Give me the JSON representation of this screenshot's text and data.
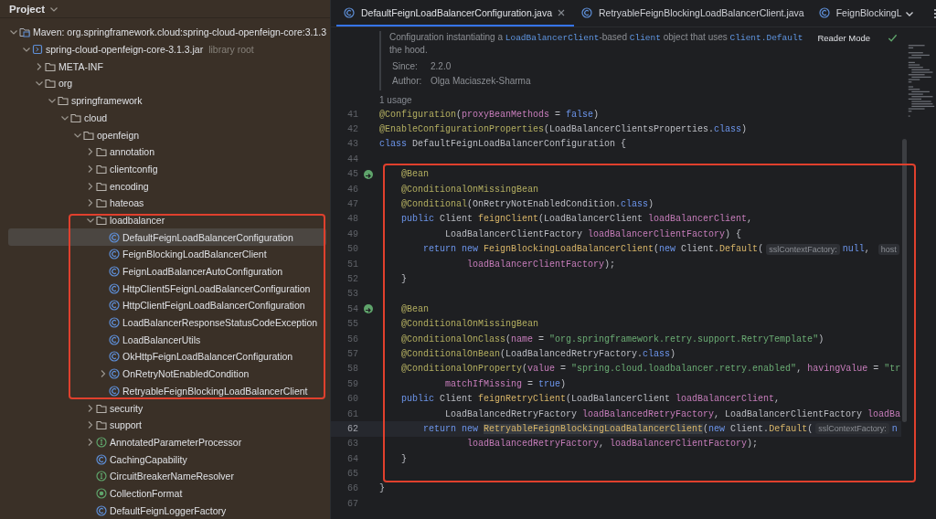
{
  "project": {
    "title": "Project",
    "tree": [
      {
        "label": "Maven: org.springframework.cloud:spring-cloud-openfeign-core:3.1.3",
        "kind": "maven",
        "expanded": true,
        "selected": false,
        "children": [
          {
            "label": "spring-cloud-openfeign-core-3.1.3.jar",
            "hint": "library root",
            "kind": "jar",
            "expanded": true,
            "selected": false,
            "children": [
              {
                "label": "META-INF",
                "kind": "folder",
                "expanded": false,
                "selected": false
              },
              {
                "label": "org",
                "kind": "folder",
                "expanded": true,
                "selected": false,
                "children": [
                  {
                    "label": "springframework",
                    "kind": "folder",
                    "expanded": true,
                    "selected": false,
                    "children": [
                      {
                        "label": "cloud",
                        "kind": "folder",
                        "expanded": true,
                        "selected": false,
                        "children": [
                          {
                            "label": "openfeign",
                            "kind": "folder",
                            "expanded": true,
                            "selected": false,
                            "children": [
                              {
                                "label": "annotation",
                                "kind": "folder",
                                "expanded": false,
                                "selected": false
                              },
                              {
                                "label": "clientconfig",
                                "kind": "folder",
                                "expanded": false,
                                "selected": false
                              },
                              {
                                "label": "encoding",
                                "kind": "folder",
                                "expanded": false,
                                "selected": false
                              },
                              {
                                "label": "hateoas",
                                "kind": "folder",
                                "expanded": false,
                                "selected": false
                              },
                              {
                                "label": "loadbalancer",
                                "kind": "folder",
                                "expanded": true,
                                "selected": false,
                                "children": [
                                  {
                                    "label": "DefaultFeignLoadBalancerConfiguration",
                                    "kind": "class",
                                    "selected": true
                                  },
                                  {
                                    "label": "FeignBlockingLoadBalancerClient",
                                    "kind": "class",
                                    "selected": false
                                  },
                                  {
                                    "label": "FeignLoadBalancerAutoConfiguration",
                                    "kind": "class",
                                    "selected": false
                                  },
                                  {
                                    "label": "HttpClient5FeignLoadBalancerConfiguration",
                                    "kind": "class",
                                    "selected": false
                                  },
                                  {
                                    "label": "HttpClientFeignLoadBalancerConfiguration",
                                    "kind": "class",
                                    "selected": false
                                  },
                                  {
                                    "label": "LoadBalancerResponseStatusCodeException",
                                    "kind": "class",
                                    "selected": false
                                  },
                                  {
                                    "label": "LoadBalancerUtils",
                                    "kind": "class",
                                    "selected": false
                                  },
                                  {
                                    "label": "OkHttpFeignLoadBalancerConfiguration",
                                    "kind": "class",
                                    "selected": false
                                  },
                                  {
                                    "label": "OnRetryNotEnabledCondition",
                                    "kind": "class",
                                    "expanded": false,
                                    "selected": false
                                  },
                                  {
                                    "label": "RetryableFeignBlockingLoadBalancerClient",
                                    "kind": "class",
                                    "selected": false
                                  }
                                ]
                              },
                              {
                                "label": "security",
                                "kind": "folder",
                                "expanded": false,
                                "selected": false
                              },
                              {
                                "label": "support",
                                "kind": "folder",
                                "expanded": false,
                                "selected": false
                              },
                              {
                                "label": "AnnotatedParameterProcessor",
                                "kind": "interface",
                                "expanded": false,
                                "selected": false
                              },
                              {
                                "label": "CachingCapability",
                                "kind": "class",
                                "selected": false
                              },
                              {
                                "label": "CircuitBreakerNameResolver",
                                "kind": "interface",
                                "selected": false
                              },
                              {
                                "label": "CollectionFormat",
                                "kind": "enum",
                                "selected": false
                              },
                              {
                                "label": "DefaultFeignLoggerFactory",
                                "kind": "class",
                                "selected": false
                              }
                            ]
                          }
                        ]
                      }
                    ]
                  }
                ]
              }
            ]
          }
        ]
      }
    ]
  },
  "editor": {
    "tabs": [
      {
        "label": "DefaultFeignLoadBalancerConfiguration.java",
        "selected": true
      },
      {
        "label": "RetryableFeignBlockingLoadBalancerClient.java",
        "selected": false
      },
      {
        "label": "FeignBlockingL",
        "selected": false
      }
    ],
    "reader_mode": "Reader Mode",
    "doc": {
      "lines": [
        [
          {
            "text": "Configuration instantiating a ",
            "kind": "prose"
          },
          {
            "text": "LoadBalancerClient",
            "kind": "code"
          },
          {
            "text": "-based ",
            "kind": "prose"
          },
          {
            "text": "Client",
            "kind": "code"
          },
          {
            "text": " object that uses ",
            "kind": "prose"
          },
          {
            "text": "Client.Default",
            "kind": "code"
          }
        ],
        [
          {
            "text": "the hood.",
            "kind": "prose"
          }
        ]
      ],
      "since_label": "Since:",
      "since": "2.2.0",
      "author_label": "Author:",
      "author": "Olga Maciaszek-Sharma"
    },
    "usages": "1 usage",
    "lines": [
      {
        "number": "41",
        "current": false,
        "tokens": [
          {
            "text": "@Configuration",
            "kind": "ann"
          },
          {
            "text": "(",
            "kind": "plain"
          },
          {
            "text": "proxyBeanMethods",
            "kind": "param"
          },
          {
            "text": " = ",
            "kind": "plain"
          },
          {
            "text": "false",
            "kind": "kw"
          },
          {
            "text": ")",
            "kind": "plain"
          }
        ]
      },
      {
        "number": "42",
        "current": false,
        "tokens": [
          {
            "text": "@EnableConfigurationProperties",
            "kind": "ann"
          },
          {
            "text": "(LoadBalancerClientsProperties.",
            "kind": "plain"
          },
          {
            "text": "class",
            "kind": "kw"
          },
          {
            "text": ")",
            "kind": "plain"
          }
        ]
      },
      {
        "number": "43",
        "current": false,
        "tokens": [
          {
            "text": "class",
            "kind": "kw"
          },
          {
            "text": " DefaultFeignLoadBalancerConfiguration {",
            "kind": "plain"
          }
        ]
      },
      {
        "number": "44",
        "current": false
      },
      {
        "number": "45",
        "current": false,
        "bean_marker": true,
        "tokens": [
          {
            "text": "    @Bean",
            "kind": "ann"
          }
        ]
      },
      {
        "number": "46",
        "current": false,
        "tokens": [
          {
            "text": "    @ConditionalOnMissingBean",
            "kind": "ann"
          }
        ]
      },
      {
        "number": "47",
        "current": false,
        "tokens": [
          {
            "text": "    @Conditional",
            "kind": "ann"
          },
          {
            "text": "(OnRetryNotEnabledCondition.",
            "kind": "plain"
          },
          {
            "text": "class",
            "kind": "kw"
          },
          {
            "text": ")",
            "kind": "plain"
          }
        ]
      },
      {
        "number": "48",
        "current": false,
        "tokens": [
          {
            "text": "    public",
            "kind": "kw"
          },
          {
            "text": " Client ",
            "kind": "plain"
          },
          {
            "text": "feignClient",
            "kind": "fn"
          },
          {
            "text": "(LoadBalancerClient ",
            "kind": "plain"
          },
          {
            "text": "loadBalancerClient",
            "kind": "param"
          },
          {
            "text": ",",
            "kind": "plain"
          }
        ]
      },
      {
        "number": "49",
        "current": false,
        "tokens": [
          {
            "text": "            LoadBalancerClientFactory ",
            "kind": "plain"
          },
          {
            "text": "loadBalancerClientFactory",
            "kind": "param"
          },
          {
            "text": ") {",
            "kind": "plain"
          }
        ]
      },
      {
        "number": "50",
        "current": false,
        "tokens": [
          {
            "text": "        return new ",
            "kind": "kw"
          },
          {
            "text": "FeignBlockingLoadBalancerClient",
            "kind": "fn"
          },
          {
            "text": "(",
            "kind": "plain"
          },
          {
            "text": "new ",
            "kind": "kw"
          },
          {
            "text": "Client.",
            "kind": "plain"
          },
          {
            "text": "Default",
            "kind": "fn"
          },
          {
            "text": "(",
            "kind": "plain"
          },
          {
            "text": "sslContextFactory:",
            "kind": "hint"
          },
          {
            "text": "null",
            "kind": "kw"
          },
          {
            "text": ", ",
            "kind": "plain"
          },
          {
            "text": "host",
            "kind": "hint"
          }
        ]
      },
      {
        "number": "51",
        "current": false,
        "tokens": [
          {
            "text": "                loadBalancerClientFactory",
            "kind": "param"
          },
          {
            "text": ");",
            "kind": "plain"
          }
        ]
      },
      {
        "number": "52",
        "current": false,
        "tokens": [
          {
            "text": "    }",
            "kind": "plain"
          }
        ]
      },
      {
        "number": "53",
        "current": false
      },
      {
        "number": "54",
        "current": false,
        "bean_marker": true,
        "tokens": [
          {
            "text": "    @Bean",
            "kind": "ann"
          }
        ]
      },
      {
        "number": "55",
        "current": false,
        "tokens": [
          {
            "text": "    @ConditionalOnMissingBean",
            "kind": "ann"
          }
        ]
      },
      {
        "number": "56",
        "current": false,
        "tokens": [
          {
            "text": "    @ConditionalOnClass",
            "kind": "ann"
          },
          {
            "text": "(",
            "kind": "plain"
          },
          {
            "text": "name",
            "kind": "param"
          },
          {
            "text": " = ",
            "kind": "plain"
          },
          {
            "text": "\"org.springframework.retry.support.RetryTemplate\"",
            "kind": "str"
          },
          {
            "text": ")",
            "kind": "plain"
          }
        ]
      },
      {
        "number": "57",
        "current": false,
        "tokens": [
          {
            "text": "    @ConditionalOnBean",
            "kind": "ann"
          },
          {
            "text": "(LoadBalancedRetryFactory.",
            "kind": "plain"
          },
          {
            "text": "class",
            "kind": "kw"
          },
          {
            "text": ")",
            "kind": "plain"
          }
        ]
      },
      {
        "number": "58",
        "current": false,
        "tokens": [
          {
            "text": "    @ConditionalOnProperty",
            "kind": "ann"
          },
          {
            "text": "(",
            "kind": "plain"
          },
          {
            "text": "value",
            "kind": "param"
          },
          {
            "text": " = ",
            "kind": "plain"
          },
          {
            "text": "\"spring.cloud.loadbalancer.retry.enabled\"",
            "kind": "str"
          },
          {
            "text": ", ",
            "kind": "plain"
          },
          {
            "text": "havingValue",
            "kind": "param"
          },
          {
            "text": " = ",
            "kind": "plain"
          },
          {
            "text": "\"tr",
            "kind": "str"
          }
        ]
      },
      {
        "number": "59",
        "current": false,
        "tokens": [
          {
            "text": "            matchIfMissing",
            "kind": "param"
          },
          {
            "text": " = ",
            "kind": "plain"
          },
          {
            "text": "true",
            "kind": "kw"
          },
          {
            "text": ")",
            "kind": "plain"
          }
        ]
      },
      {
        "number": "60",
        "current": false,
        "tokens": [
          {
            "text": "    public",
            "kind": "kw"
          },
          {
            "text": " Client ",
            "kind": "plain"
          },
          {
            "text": "feignRetryClient",
            "kind": "fn"
          },
          {
            "text": "(LoadBalancerClient ",
            "kind": "plain"
          },
          {
            "text": "loadBalancerClient",
            "kind": "param"
          },
          {
            "text": ",",
            "kind": "plain"
          }
        ]
      },
      {
        "number": "61",
        "current": false,
        "tokens": [
          {
            "text": "            LoadBalancedRetryFactory ",
            "kind": "plain"
          },
          {
            "text": "loadBalancedRetryFactory",
            "kind": "param"
          },
          {
            "text": ", LoadBalancerClientFactory ",
            "kind": "plain"
          },
          {
            "text": "loadBa",
            "kind": "param"
          }
        ]
      },
      {
        "number": "62",
        "current": true,
        "tokens": [
          {
            "text": "        return new ",
            "kind": "kw"
          },
          {
            "text": "RetryableFeignBlockingLoadBalancerClient",
            "kind": "fn",
            "highlighted": true
          },
          {
            "text": "(",
            "kind": "plain"
          },
          {
            "text": "new ",
            "kind": "kw"
          },
          {
            "text": "Client.",
            "kind": "plain"
          },
          {
            "text": "Default",
            "kind": "fn"
          },
          {
            "text": "(",
            "kind": "plain"
          },
          {
            "text": "sslContextFactory:",
            "kind": "hint"
          },
          {
            "text": "n",
            "kind": "kw"
          }
        ]
      },
      {
        "number": "63",
        "current": false,
        "tokens": [
          {
            "text": "                loadBalancedRetryFactory",
            "kind": "param"
          },
          {
            "text": ", ",
            "kind": "plain"
          },
          {
            "text": "loadBalancerClientFactory",
            "kind": "param"
          },
          {
            "text": ");",
            "kind": "plain"
          }
        ]
      },
      {
        "number": "64",
        "current": false,
        "tokens": [
          {
            "text": "    }",
            "kind": "plain"
          }
        ]
      },
      {
        "number": "65",
        "current": false
      },
      {
        "number": "66",
        "current": false,
        "tokens": [
          {
            "text": "}",
            "kind": "plain"
          }
        ]
      },
      {
        "number": "67",
        "current": false
      }
    ]
  }
}
